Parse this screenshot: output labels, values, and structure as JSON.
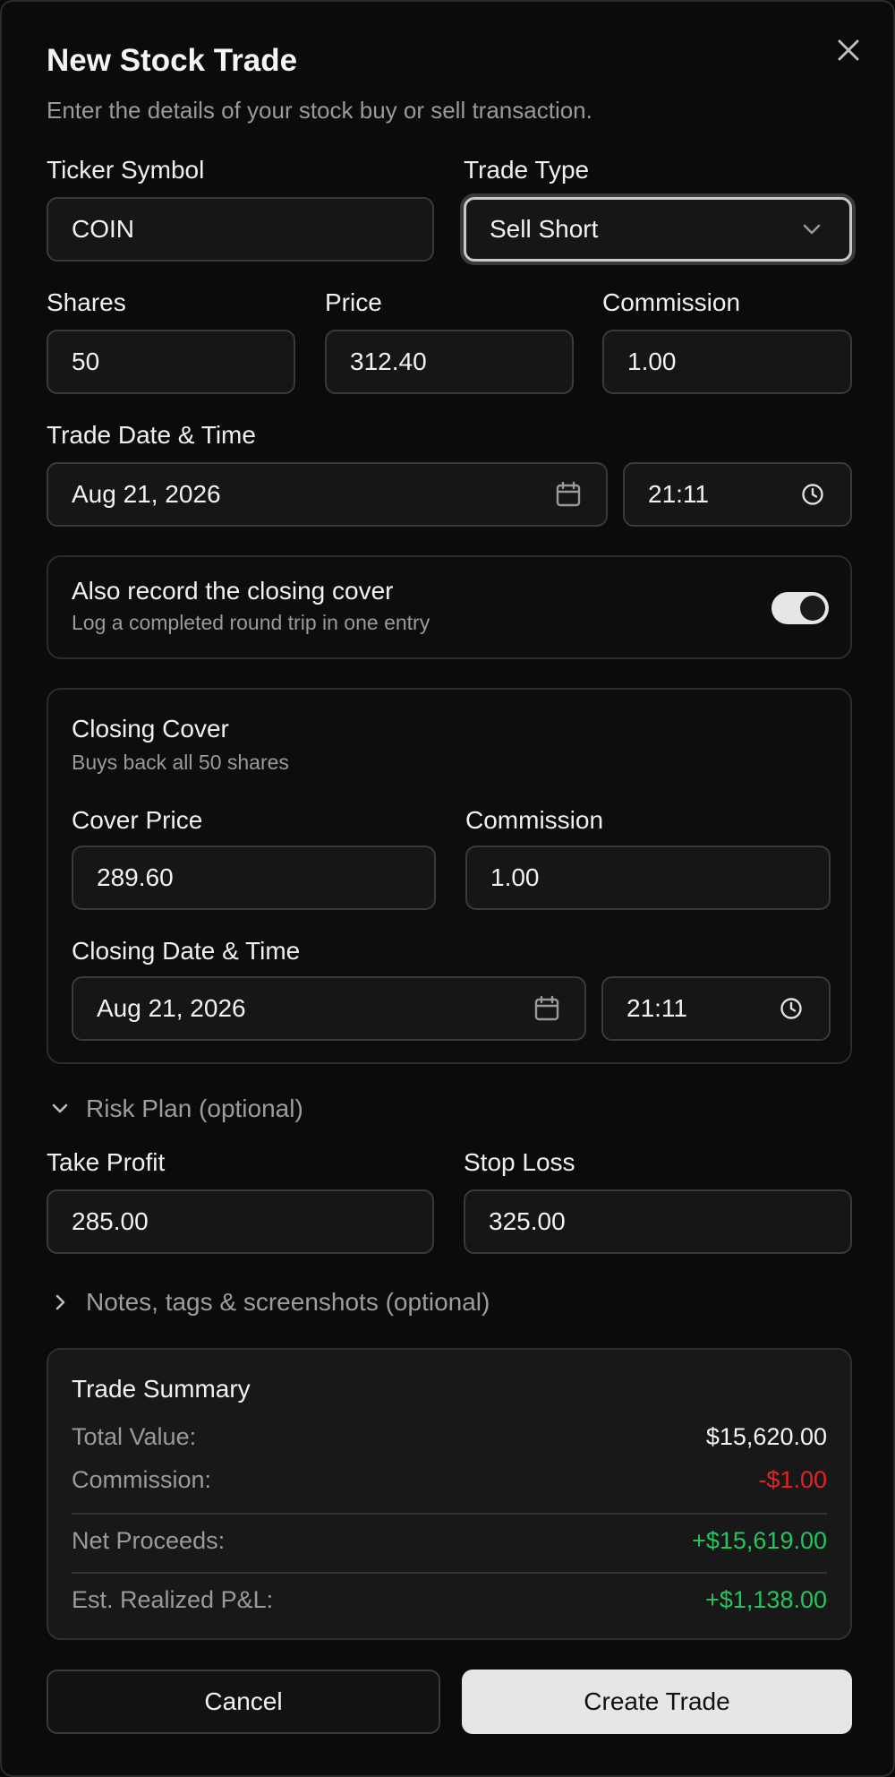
{
  "dialog": {
    "title": "New Stock Trade",
    "subtitle": "Enter the details of your stock buy or sell transaction."
  },
  "ticker": {
    "label": "Ticker Symbol",
    "value": "COIN"
  },
  "trade_type": {
    "label": "Trade Type",
    "value": "Sell Short"
  },
  "shares": {
    "label": "Shares",
    "value": "50"
  },
  "price": {
    "label": "Price",
    "value": "312.40"
  },
  "commission": {
    "label": "Commission",
    "value": "1.00"
  },
  "trade_datetime": {
    "label": "Trade Date & Time",
    "date": "Aug 21, 2026",
    "time": "21:11"
  },
  "closing_toggle": {
    "title": "Also record the closing cover",
    "subtitle": "Log a completed round trip in one entry",
    "enabled": true
  },
  "closing_cover": {
    "title": "Closing Cover",
    "subtitle": "Buys back all 50 shares",
    "cover_price_label": "Cover Price",
    "cover_price": "289.60",
    "commission_label": "Commission",
    "commission": "1.00",
    "datetime_label": "Closing Date & Time",
    "date": "Aug 21, 2026",
    "time": "21:11"
  },
  "risk_plan": {
    "label": "Risk Plan (optional)",
    "take_profit_label": "Take Profit",
    "take_profit": "285.00",
    "stop_loss_label": "Stop Loss",
    "stop_loss": "325.00"
  },
  "notes": {
    "label": "Notes, tags & screenshots (optional)"
  },
  "summary": {
    "title": "Trade Summary",
    "total_value_label": "Total Value:",
    "total_value": "$15,620.00",
    "commission_label": "Commission:",
    "commission": "-$1.00",
    "net_proceeds_label": "Net Proceeds:",
    "net_proceeds": "+$15,619.00",
    "realized_label": "Est. Realized P&L:",
    "realized": "+$1,138.00"
  },
  "actions": {
    "cancel": "Cancel",
    "create": "Create Trade"
  },
  "colors": {
    "positive": "#22c55e",
    "negative": "#e02424",
    "accent": "#e6e6e6"
  }
}
